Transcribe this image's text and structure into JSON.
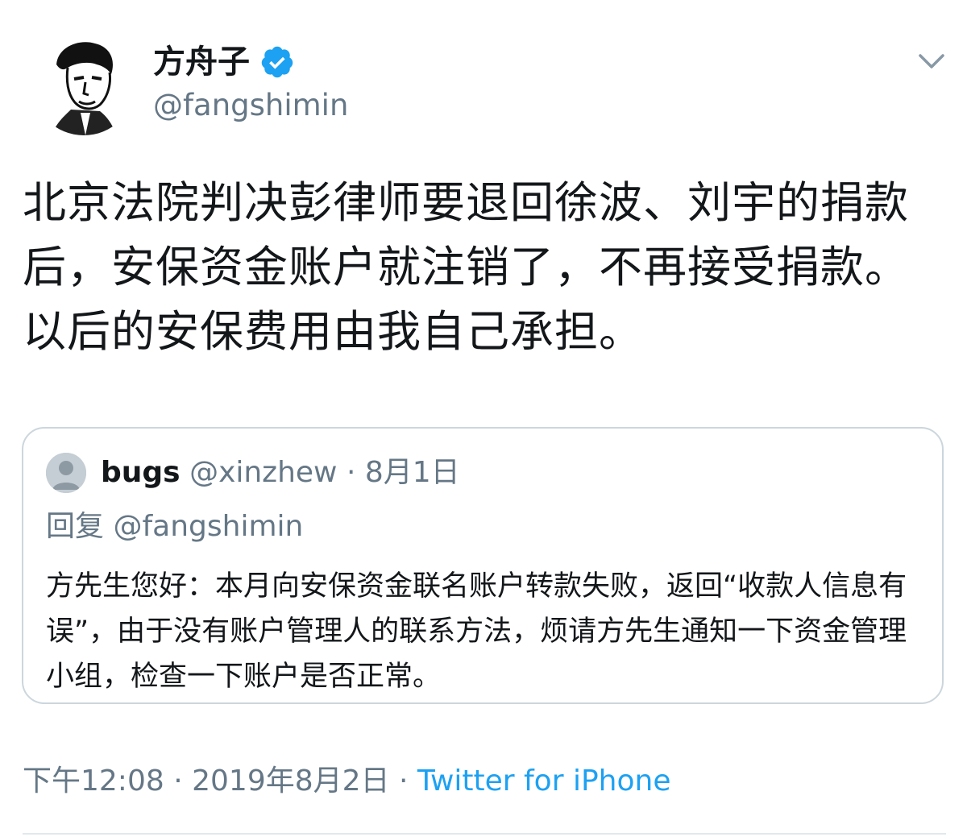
{
  "author": {
    "display_name": "方舟子",
    "handle": "@fangshimin",
    "verified_icon": "verified-badge-icon"
  },
  "tweet": {
    "text": "北京法院判决彭律师要退回徐波、刘宇的捐款后，安保资金账户就注销了，不再接受捐款。以后的安保费用由我自己承担。"
  },
  "quoted_tweet": {
    "display_name": "bugs",
    "handle": "@xinzhew",
    "separator": "·",
    "date": "8月1日",
    "reply_prefix": "回复",
    "reply_to": "@fangshimin",
    "text": "方先生您好：本月向安保资金联名账户转款失败，返回“收款人信息有误”，由于没有账户管理人的联系方法，烦请方先生通知一下资金管理小组，检查一下账户是否正常。"
  },
  "meta": {
    "time": "下午12:08",
    "separator1": "·",
    "date": "2019年8月2日",
    "separator2": "·",
    "source": "Twitter for iPhone"
  },
  "colors": {
    "accent": "#1da1f2",
    "secondary_text": "#657786",
    "border": "#ccd6dd"
  }
}
